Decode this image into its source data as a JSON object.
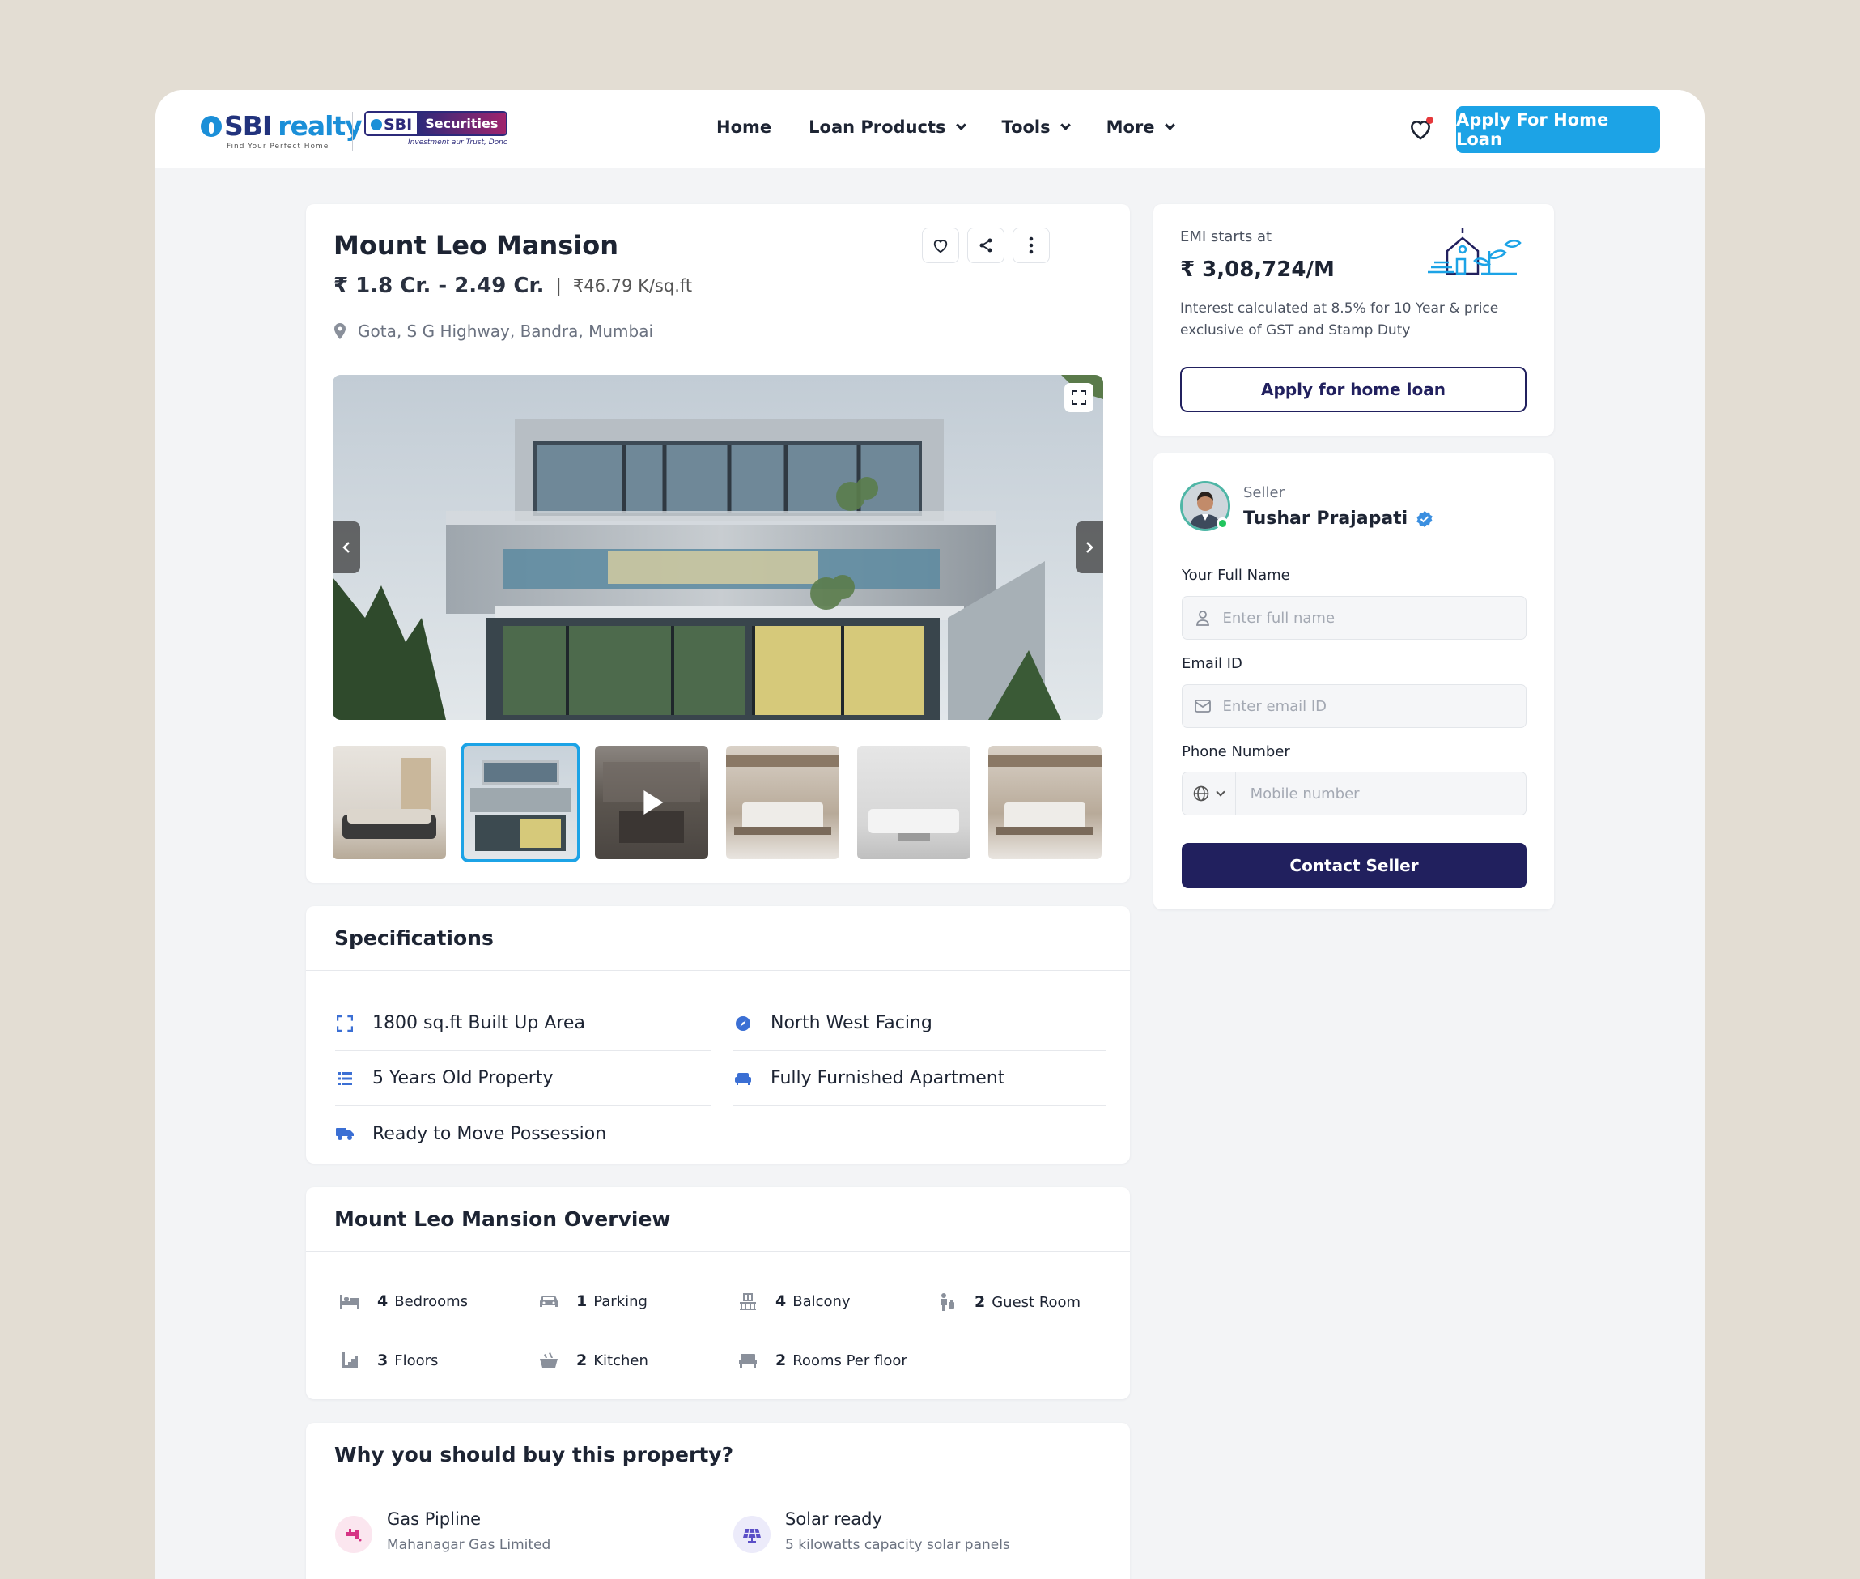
{
  "header": {
    "logo": {
      "brand_sbi": "SBI",
      "brand_realty": "realty",
      "tagline": "Find Your Perfect Home"
    },
    "partner_logo": {
      "sbi": "SBI",
      "name": "Securities",
      "tagline": "Investment aur Trust, Dono"
    },
    "nav": [
      {
        "label": "Home",
        "dropdown": false
      },
      {
        "label": "Loan Products",
        "dropdown": true
      },
      {
        "label": "Tools",
        "dropdown": true
      },
      {
        "label": "More",
        "dropdown": true
      }
    ],
    "favorites_icon": "heart-icon",
    "notification_color": "#e5383b",
    "cta_label": "Apply For Home Loan",
    "cta_color": "#1ca3e6"
  },
  "property": {
    "title": "Mount Leo Mansion",
    "price_range": "₹ 1.8 Cr. - 2.49 Cr.",
    "separator": "|",
    "price_per_sqft": "₹46.79 K/sq.ft",
    "location": "Gota, S G Highway, Bandra, Mumbai",
    "actions": [
      "heart-icon",
      "share-icon",
      "more-vertical-icon"
    ],
    "gallery": {
      "active_thumbnail": 2,
      "thumbnails": [
        {
          "type": "image",
          "scene": "sofa"
        },
        {
          "type": "image",
          "scene": "building",
          "active": true
        },
        {
          "type": "video",
          "scene": "dining"
        },
        {
          "type": "image",
          "scene": "living-room"
        },
        {
          "type": "image",
          "scene": "white-sofa"
        },
        {
          "type": "image",
          "scene": "living-room"
        }
      ]
    }
  },
  "specifications": {
    "heading": "Specifications",
    "items": [
      {
        "icon": "expand-area-icon",
        "label": "1800 sq.ft Built Up Area"
      },
      {
        "icon": "compass-icon",
        "label": "North West Facing"
      },
      {
        "icon": "list-icon",
        "label": "5 Years Old Property"
      },
      {
        "icon": "sofa-icon",
        "label": "Fully Furnished Apartment"
      },
      {
        "icon": "truck-icon",
        "label": "Ready to Move Possession"
      }
    ]
  },
  "overview": {
    "heading": "Mount Leo Mansion Overview",
    "items": [
      {
        "icon": "bed-icon",
        "count": "4",
        "label": "Bedrooms"
      },
      {
        "icon": "car-icon",
        "count": "1",
        "label": "Parking"
      },
      {
        "icon": "balcony-icon",
        "count": "4",
        "label": "Balcony"
      },
      {
        "icon": "guest-icon",
        "count": "2",
        "label": "Guest Room"
      },
      {
        "icon": "stairs-icon",
        "count": "3",
        "label": "Floors"
      },
      {
        "icon": "kitchen-icon",
        "count": "2",
        "label": "Kitchen"
      },
      {
        "icon": "room-icon",
        "count": "2",
        "label": "Rooms Per floor"
      }
    ]
  },
  "why_buy": {
    "heading": "Why you should buy this property?",
    "items": [
      {
        "icon": "gas-pipe-icon",
        "title": "Gas Pipline",
        "subtitle": "Mahanagar Gas Limited",
        "color": "#d63384"
      },
      {
        "icon": "solar-panel-icon",
        "title": "Solar ready",
        "subtitle": "5 kilowatts capacity solar panels",
        "color": "#5b4fc7"
      }
    ]
  },
  "emi": {
    "label": "EMI starts at",
    "value": "₹ 3,08,724/M",
    "note": "Interest calculated at 8.5%  for 10 Year & price exclusive of GST and Stamp Duty",
    "button_label": "Apply for home loan",
    "illustration": "house-plant-icon"
  },
  "seller": {
    "role": "Seller",
    "name": "Tushar Prajapati",
    "verified_icon": "verified-badge-icon",
    "online_status_color": "#22c55e",
    "form": {
      "name_label": "Your Full Name",
      "name_placeholder": "Enter full name",
      "email_label": "Email ID",
      "email_placeholder": "Enter email ID",
      "phone_label": "Phone Number",
      "phone_placeholder": "Mobile number",
      "country_icon": "globe-icon"
    },
    "submit_label": "Contact Seller",
    "submit_color": "#21205e"
  }
}
